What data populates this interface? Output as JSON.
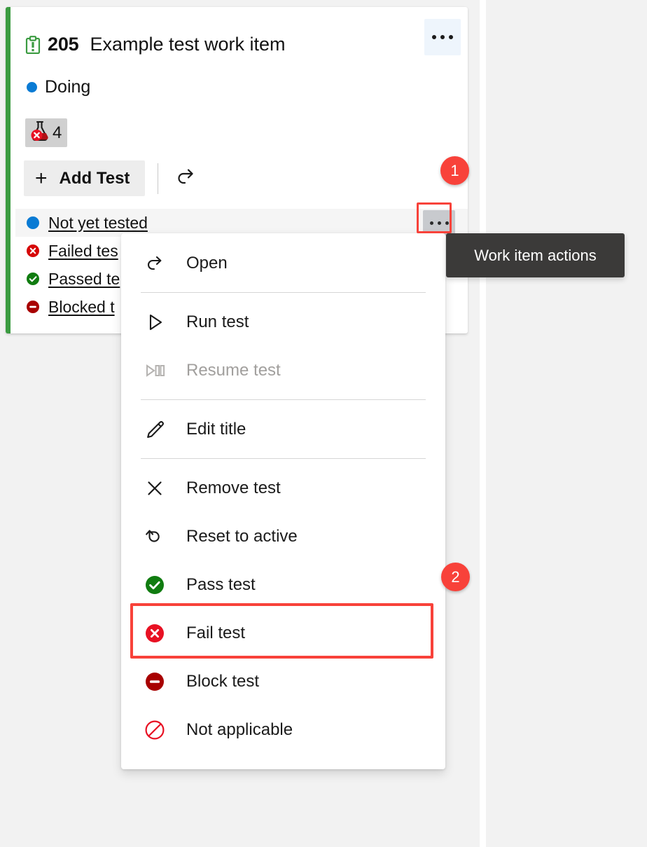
{
  "card": {
    "work_item_icon": "task-clipboard-icon",
    "id": "205",
    "title": "Example test work item",
    "state": "Doing",
    "state_color": "#0a7bd4",
    "accent_color": "#3b9b41",
    "test_badge": {
      "icon": "failed-flask-icon",
      "count": "4"
    },
    "card_menu_label": "…",
    "toolbar": {
      "add_test_label": "Add Test",
      "add_icon": "plus-icon",
      "refresh_icon": "refresh-arrow-icon"
    },
    "tests": [
      {
        "name": "Not yet tested",
        "status": "not-yet-tested",
        "status_color": "#0a7bd4",
        "hovered": true
      },
      {
        "name": "Failed tes",
        "status": "failed",
        "status_color": "#d60707",
        "hovered": false
      },
      {
        "name": "Passed te",
        "status": "passed",
        "status_color": "#107c10",
        "hovered": false
      },
      {
        "name": "Blocked t",
        "status": "blocked",
        "status_color": "#a80000",
        "hovered": false
      }
    ]
  },
  "tooltip": {
    "text": "Work item actions",
    "background": "#3b3a39"
  },
  "callouts": [
    {
      "number": "1",
      "color": "#f8423a"
    },
    {
      "number": "2",
      "color": "#f8423a"
    }
  ],
  "context_menu": {
    "items": [
      {
        "label": "Open",
        "icon": "open-arrow-icon",
        "disabled": false,
        "highlighted": false
      },
      {
        "label": "Run test",
        "icon": "play-icon",
        "disabled": false,
        "highlighted": false
      },
      {
        "label": "Resume test",
        "icon": "play-pause-icon",
        "disabled": true,
        "highlighted": false
      },
      {
        "label": "Edit title",
        "icon": "pencil-icon",
        "disabled": false,
        "highlighted": false
      },
      {
        "label": "Remove test",
        "icon": "close-x-icon",
        "disabled": false,
        "highlighted": false
      },
      {
        "label": "Reset to active",
        "icon": "undo-icon",
        "disabled": false,
        "highlighted": false
      },
      {
        "label": "Pass test",
        "icon": "pass-check-icon",
        "disabled": false,
        "highlighted": true
      },
      {
        "label": "Fail test",
        "icon": "fail-x-icon",
        "disabled": false,
        "highlighted": false
      },
      {
        "label": "Block test",
        "icon": "block-minus-icon",
        "disabled": false,
        "highlighted": false
      },
      {
        "label": "Not applicable",
        "icon": "not-applicable-icon",
        "disabled": false,
        "highlighted": false
      }
    ]
  },
  "highlight_color": "#f8423a"
}
